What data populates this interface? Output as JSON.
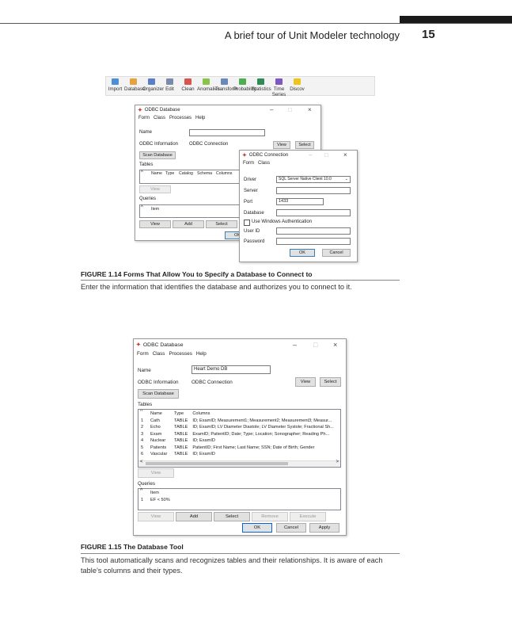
{
  "header": {
    "running_head": "A brief tour of Unit Modeler technology",
    "page_number": "15"
  },
  "toolbar": {
    "items": [
      {
        "label": "Import",
        "icon": "import-icon",
        "color": "#4a8fd8"
      },
      {
        "label": "Database",
        "icon": "database-icon",
        "color": "#e6a23c"
      },
      {
        "label": "Organizer",
        "icon": "organizer-icon",
        "color": "#5b7fc7"
      },
      {
        "label": "Edit",
        "icon": "edit-icon",
        "color": "#7a8aa8"
      },
      {
        "label": "Clean",
        "icon": "clean-icon",
        "color": "#d9534f"
      },
      {
        "label": "Anomalies",
        "icon": "anomalies-icon",
        "color": "#8bc34a"
      },
      {
        "label": "Transform",
        "icon": "transform-icon",
        "color": "#6a88b8"
      },
      {
        "label": "Probability",
        "icon": "probability-icon",
        "color": "#4caf50"
      },
      {
        "label": "Statistics",
        "icon": "statistics-icon",
        "color": "#2e8b57"
      },
      {
        "label": "Time Series",
        "icon": "timeseries-icon",
        "color": "#7e57c2"
      },
      {
        "label": "Discov",
        "icon": "discover-icon",
        "color": "#f0c419"
      }
    ]
  },
  "fig14": {
    "win1": {
      "title": "ODBC Database",
      "menu": [
        "Form",
        "Class",
        "Processes",
        "Help"
      ],
      "name_label": "Name",
      "odbc_label": "ODBC Information",
      "odbc_value": "ODBC Connection",
      "view": "View",
      "select": "Select",
      "scan": "Scan Database",
      "tables_label": "Tables",
      "table_headers": [
        "Name",
        "Type",
        "Catalog",
        "Schema",
        "Columns"
      ],
      "queries_label": "Queries",
      "query_header": "Item",
      "buttons": [
        "View",
        "Add",
        "Select"
      ],
      "ok": "OK"
    },
    "win2": {
      "title": "ODBC Connection",
      "menu": [
        "Form",
        "Class"
      ],
      "driver_label": "Driver",
      "driver_value": "SQL Server Native Client 10.0",
      "server_label": "Server",
      "port_label": "Port",
      "port_value": "1433",
      "database_label": "Database",
      "windows_auth": "Use Windows Authentication",
      "user_label": "User ID",
      "password_label": "Password",
      "ok": "OK",
      "cancel": "Cancel"
    },
    "caption_title": "FIGURE 1.14  Forms That Allow You to Specify a Database to Connect to",
    "caption_text": "Enter the information that identifies the database and authorizes you to connect to it."
  },
  "fig15": {
    "title": "ODBC Database",
    "menu": [
      "Form",
      "Class",
      "Processes",
      "Help"
    ],
    "name_label": "Name",
    "name_value": "Heart Demo DB",
    "odbc_label": "ODBC Information",
    "odbc_value": "ODBC Connection",
    "view": "View",
    "select": "Select",
    "scan": "Scan Database",
    "tables_label": "Tables",
    "table_headers": [
      "",
      "Name",
      "Type",
      "Columns"
    ],
    "table_rows": [
      [
        "1",
        "Cath",
        "TABLE",
        "ID; ExamID; Measurement1; Measurement2; Measurement3; Measur..."
      ],
      [
        "2",
        "Echo",
        "TABLE",
        "ID; ExamID; LV Diameter Diastole; LV Diameter Systole; Fractional Sh..."
      ],
      [
        "3",
        "Exam",
        "TABLE",
        "ExamID; PatientID; Date; Type; Location; Sonographer; Reading Ph..."
      ],
      [
        "4",
        "Nuclear",
        "TABLE",
        "ID; ExamID"
      ],
      [
        "5",
        "Patients",
        "TABLE",
        "PatientID; First Name; Last Name; SSN; Date of Birth; Gender"
      ],
      [
        "6",
        "Vascular",
        "TABLE",
        "ID; ExamID"
      ]
    ],
    "tables_view": "View",
    "queries_label": "Queries",
    "query_header": "Item",
    "query_rows": [
      [
        "1",
        "EF < 50%"
      ]
    ],
    "buttons": [
      "View",
      "Add",
      "Select",
      "Remove",
      "Execute"
    ],
    "ok": "OK",
    "cancel": "Cancel",
    "apply": "Apply",
    "caption_title": "FIGURE 1.15  The Database Tool",
    "caption_text": "This tool automatically scans and recognizes tables and their relationships. It is aware of each table’s columns and their types."
  }
}
